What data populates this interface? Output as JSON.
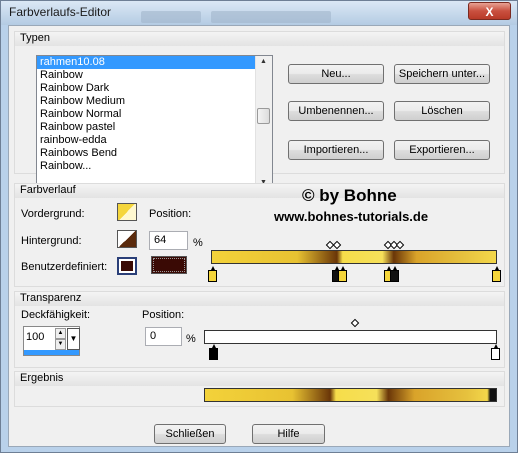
{
  "window": {
    "title": "Farbverlaufs-Editor",
    "close_label": "X"
  },
  "types": {
    "title": "Typen",
    "items": [
      "rahmen10.08",
      "Rainbow",
      "Rainbow Dark",
      "Rainbow Medium",
      "Rainbow Normal",
      "Rainbow pastel",
      "rainbow-edda",
      "Rainbows Bend",
      "Rainbow..."
    ],
    "selected_index": 0,
    "buttons": {
      "new": "Neu...",
      "save_as": "Speichern unter...",
      "rename": "Umbenennen...",
      "delete": "Löschen",
      "import": "Importieren...",
      "export": "Exportieren..."
    }
  },
  "gradient": {
    "title": "Farbverlauf",
    "foreground_label": "Vordergrund:",
    "background_label": "Hintergrund:",
    "custom_label": "Benutzerdefiniert:",
    "position_label": "Position:",
    "position_value": "64",
    "percent": "%",
    "colors": {
      "custom": "#3a0a05",
      "dark": "#5a2a0c",
      "gold": "#f5d63c"
    }
  },
  "watermark": {
    "line1": "© by Bohne",
    "line2": "www.bohnes-tutorials.de"
  },
  "transparency": {
    "title": "Transparenz",
    "opacity_label": "Deckfähigkeit:",
    "opacity_value": "100",
    "position_label": "Position:",
    "position_value": "0",
    "percent": "%"
  },
  "result": {
    "title": "Ergebnis"
  },
  "footer": {
    "close": "Schließen",
    "help": "Hilfe"
  }
}
